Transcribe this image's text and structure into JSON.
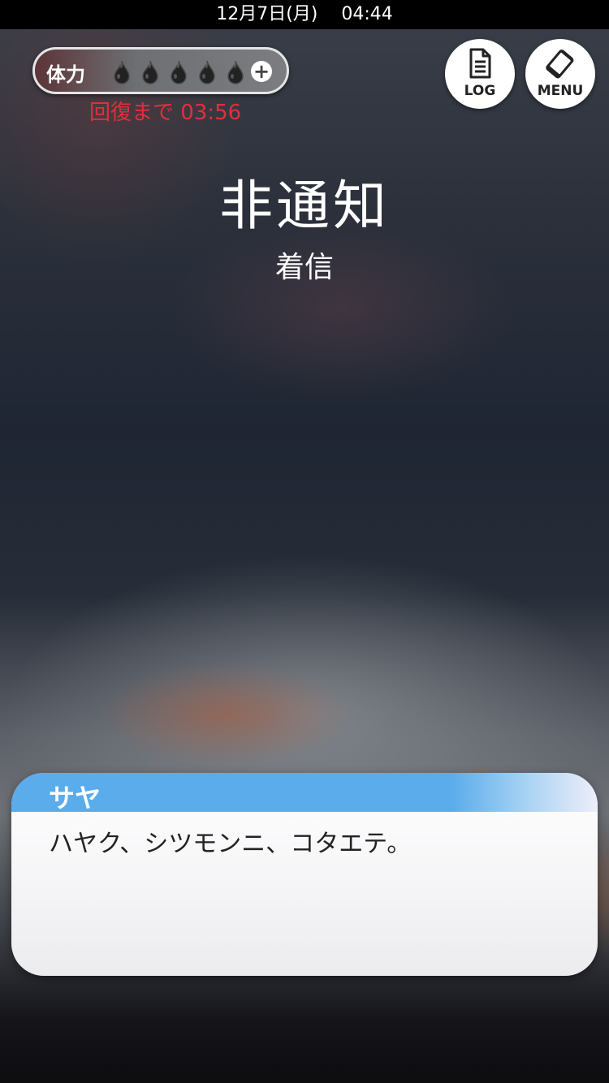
{
  "status_bar": {
    "datetime": "12月7日(月)　 04:44"
  },
  "stamina": {
    "label": "体力",
    "current": 0,
    "max": 5,
    "drop_icon": "flame-drop-icon",
    "add_icon": "plus-icon",
    "add_symbol": "+",
    "recovery_text": "回復まで 03:56",
    "recovery_color": "#e0303a"
  },
  "buttons": {
    "log_label": "LOG",
    "log_icon": "document-icon",
    "menu_label": "MENU",
    "menu_icon": "smartphone-icon"
  },
  "call": {
    "caller": "非通知",
    "status": "着信"
  },
  "dialog": {
    "speaker": "サヤ",
    "text": "ハヤク、シツモンニ、コタエテ。",
    "name_bar_color": "#5aaceb"
  }
}
